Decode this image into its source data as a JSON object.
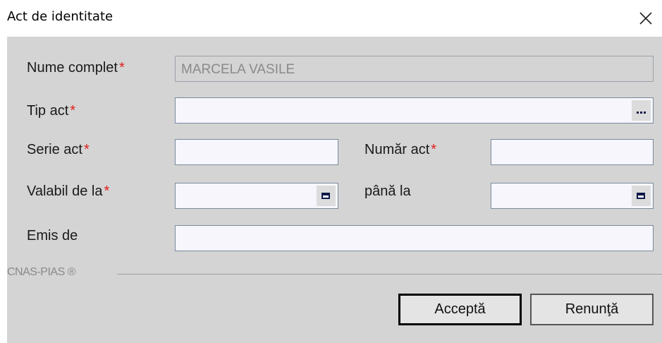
{
  "window": {
    "title": "Act de identitate",
    "close_icon": "close-icon"
  },
  "form": {
    "full_name": {
      "label": "Nume complet",
      "required": "*",
      "value": "MARCELA VASILE"
    },
    "doc_type": {
      "label": "Tip act",
      "required": "*",
      "value": "",
      "picker_icon": "ellipsis-icon"
    },
    "doc_series": {
      "label": "Serie act",
      "required": "*",
      "value": ""
    },
    "doc_number": {
      "label": "Număr act",
      "required": "*",
      "value": ""
    },
    "valid_from": {
      "label": "Valabil de la",
      "required": "*",
      "value": "",
      "picker_icon": "calendar-icon"
    },
    "valid_to": {
      "label": "până la",
      "value": "",
      "picker_icon": "calendar-icon"
    },
    "issued_by": {
      "label": "Emis de",
      "value": ""
    }
  },
  "footer": {
    "brand": "CNAS-PIAS ®"
  },
  "buttons": {
    "accept": "Acceptă",
    "cancel": "Renunţă"
  },
  "colors": {
    "panel_bg": "#d4d4d4",
    "required_asterisk": "#e0201c",
    "input_bg": "#f6f6fc"
  }
}
